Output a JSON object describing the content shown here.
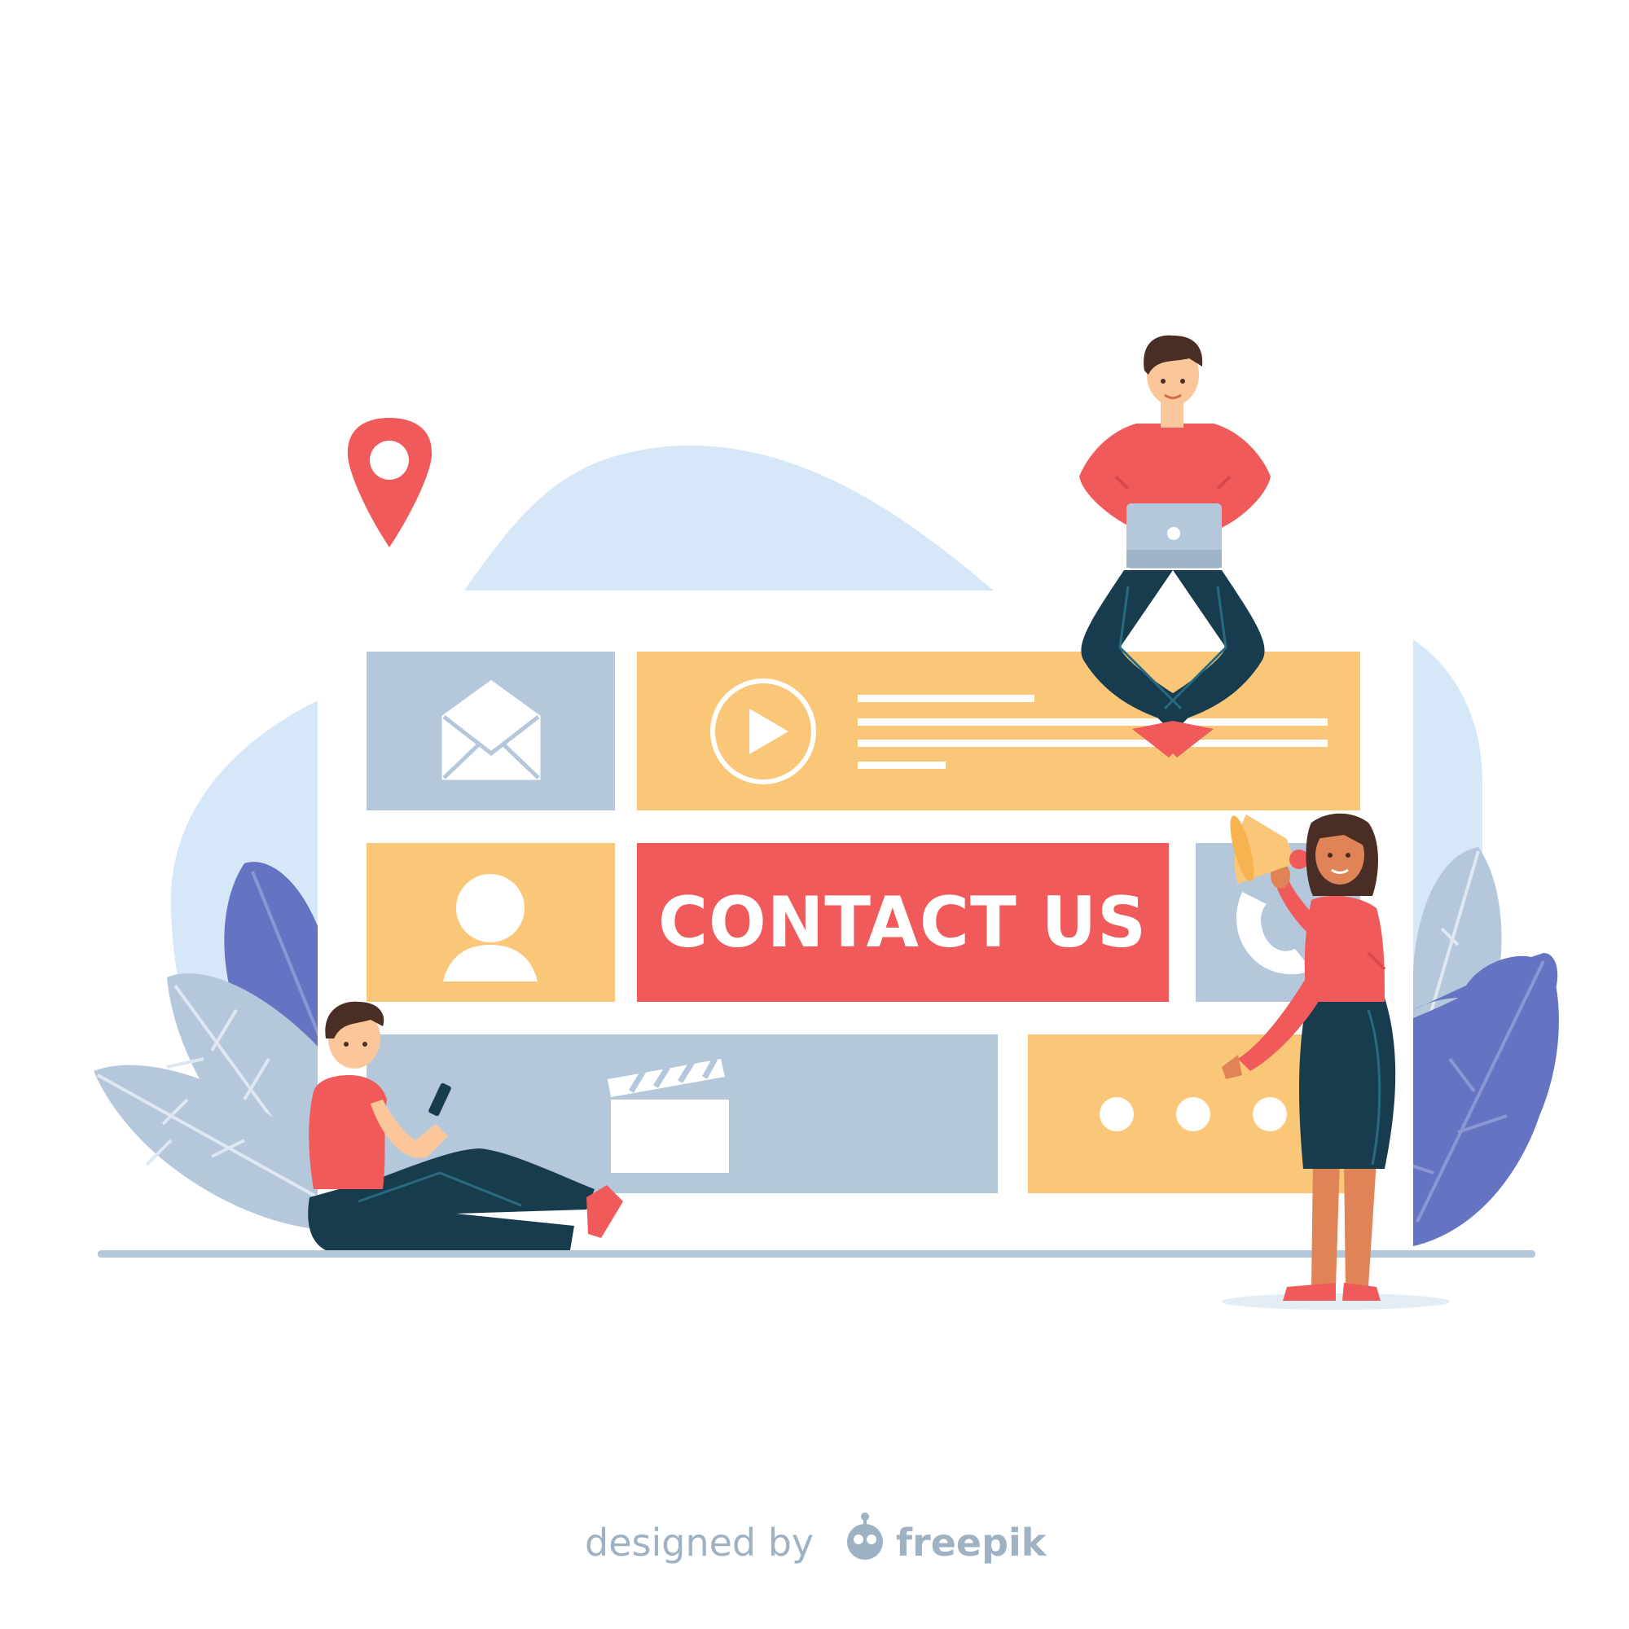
{
  "banner": {
    "title": "CONTACT US"
  },
  "credit": {
    "prefix": "designed by",
    "brand": "freepik"
  },
  "icons": [
    "location-pin-icon",
    "envelope-icon",
    "play-icon",
    "user-icon",
    "phone-icon",
    "clapperboard-icon",
    "chat-dots-icon",
    "megaphone-icon",
    "laptop-icon",
    "smartphone-icon"
  ],
  "colors": {
    "coral": "#f05a5a",
    "yellow": "#fac678",
    "slate": "#b5c8db",
    "sky": "#d6e8f8",
    "navy": "#173c4e",
    "indigo": "#6474c2",
    "credit": "#9eb2c3"
  }
}
